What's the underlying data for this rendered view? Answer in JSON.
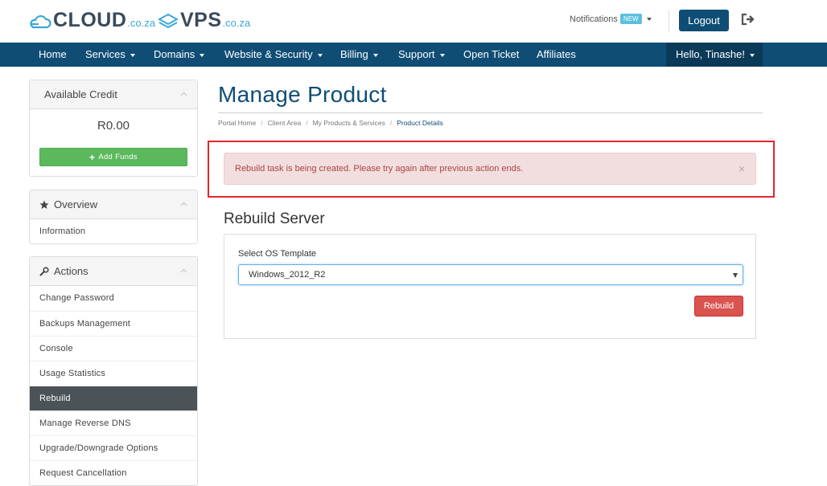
{
  "header": {
    "logo_cloud": {
      "name": "CLOUD",
      "suffix": ".co.za"
    },
    "logo_vps": {
      "name": "VPS",
      "suffix": ".co.za"
    },
    "notifications_label": "Notifications",
    "notifications_badge": "NEW",
    "logout_label": "Logout"
  },
  "nav": {
    "items": [
      {
        "label": "Home",
        "dropdown": false
      },
      {
        "label": "Services",
        "dropdown": true
      },
      {
        "label": "Domains",
        "dropdown": true
      },
      {
        "label": "Website & Security",
        "dropdown": true
      },
      {
        "label": "Billing",
        "dropdown": true
      },
      {
        "label": "Support",
        "dropdown": true
      },
      {
        "label": "Open Ticket",
        "dropdown": false
      },
      {
        "label": "Affiliates",
        "dropdown": false
      }
    ],
    "user_greeting": "Hello, Tinashe!"
  },
  "sidebar": {
    "credit": {
      "title": "Available Credit",
      "amount": "R0.00",
      "add_funds_label": "Add Funds"
    },
    "overview": {
      "title": "Overview",
      "items": [
        "Information"
      ]
    },
    "actions": {
      "title": "Actions",
      "items": [
        "Change Password",
        "Backups Management",
        "Console",
        "Usage Statistics",
        "Rebuild",
        "Manage Reverse DNS",
        "Upgrade/Downgrade Options",
        "Request Cancellation"
      ],
      "active": "Rebuild"
    }
  },
  "main": {
    "title": "Manage Product",
    "breadcrumb": [
      "Portal Home",
      "Client Area",
      "My Products & Services",
      "Product Details"
    ],
    "alert": {
      "message": "Rebuild task is being created. Please try again after previous action ends.",
      "close": "×"
    },
    "section_title": "Rebuild Server",
    "form": {
      "label": "Select OS Template",
      "selected_value": "Windows_2012_R2",
      "submit_label": "Rebuild"
    }
  },
  "colors": {
    "brand_navy": "#0f4d75",
    "nav_user_bg": "#0b3a59",
    "logo_accent": "#3aa7d8",
    "success": "#5cb85c",
    "danger": "#d9534f",
    "alert_bg": "#f2dede",
    "alert_text": "#a94442",
    "highlight": "#e3262c",
    "sidebar_active": "#4b5258"
  }
}
